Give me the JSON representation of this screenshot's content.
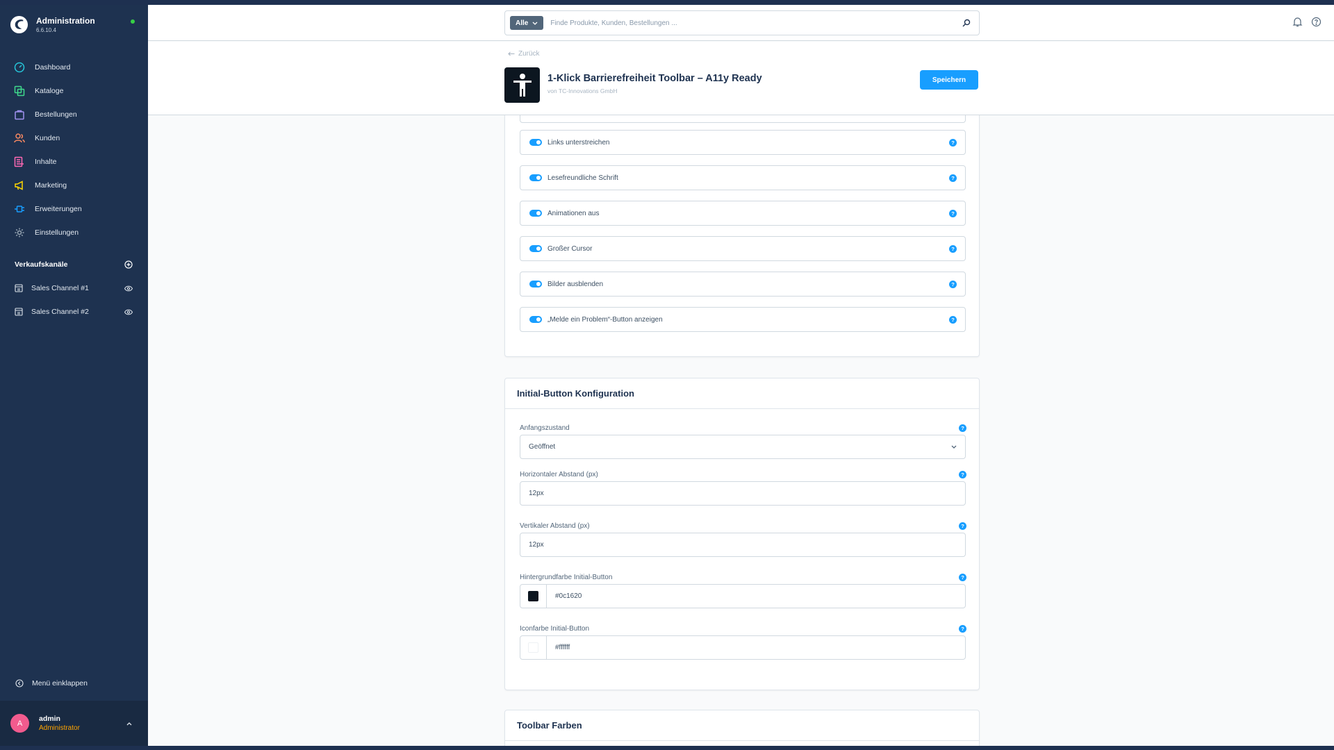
{
  "app": {
    "title": "Administration",
    "version": "6.6.10.4"
  },
  "nav": [
    {
      "label": "Dashboard",
      "icon": "dashboard-icon"
    },
    {
      "label": "Kataloge",
      "icon": "catalog-icon"
    },
    {
      "label": "Bestellungen",
      "icon": "orders-icon"
    },
    {
      "label": "Kunden",
      "icon": "customers-icon"
    },
    {
      "label": "Inhalte",
      "icon": "content-icon"
    },
    {
      "label": "Marketing",
      "icon": "megaphone-icon"
    },
    {
      "label": "Erweiterungen",
      "icon": "plug-icon"
    },
    {
      "label": "Einstellungen",
      "icon": "gear-icon"
    }
  ],
  "sales_channels": {
    "title": "Verkaufskanäle",
    "items": [
      {
        "label": "Sales Channel #1"
      },
      {
        "label": "Sales Channel #2"
      }
    ]
  },
  "sidebar_footer": {
    "collapse_label": "Menü einklappen",
    "user_initial": "A",
    "user_name": "admin",
    "user_role": "Administrator"
  },
  "search": {
    "type_label": "Alle",
    "placeholder": "Finde Produkte, Kunden, Bestellungen ..."
  },
  "smartbar": {
    "back_label": "Zurück",
    "title": "1-Klick Barrierefreiheit Toolbar – A11y Ready",
    "vendor": "von TC-Innovations GmbH",
    "save_label": "Speichern"
  },
  "switches": [
    {
      "label": "Links unterstreichen",
      "enabled": true
    },
    {
      "label": "Lesefreundliche Schrift",
      "enabled": true
    },
    {
      "label": "Animationen aus",
      "enabled": true
    },
    {
      "label": "Großer Cursor",
      "enabled": true
    },
    {
      "label": "Bilder ausblenden",
      "enabled": true
    },
    {
      "label": "„Melde ein Problem“-Button anzeigen",
      "enabled": true
    }
  ],
  "initial_button": {
    "title": "Initial-Button Konfiguration",
    "fields": {
      "state": {
        "label": "Anfangszustand",
        "value": "Geöffnet"
      },
      "horizontal": {
        "label": "Horizontaler Abstand (px)",
        "value": "12px"
      },
      "vertical": {
        "label": "Vertikaler Abstand (px)",
        "value": "12px"
      },
      "bg_color": {
        "label": "Hintergrundfarbe Initial-Button",
        "value": "#0c1620"
      },
      "icon_color": {
        "label": "Iconfarbe Initial-Button",
        "value": "#ffffff"
      }
    }
  },
  "toolbar_colors": {
    "title": "Toolbar Farben"
  },
  "colors": {
    "sidebar": "#1e3250",
    "accent": "#189eff",
    "role": "#ffa400"
  }
}
